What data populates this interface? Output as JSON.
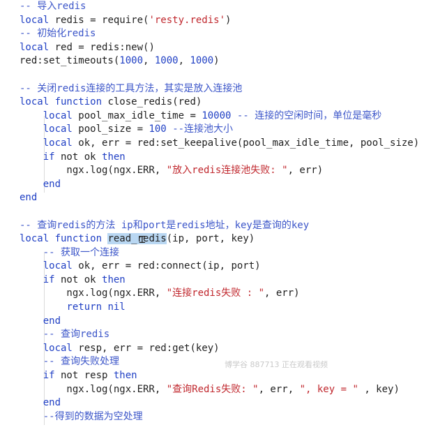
{
  "editor": {
    "lines": [
      {
        "n": "",
        "segs": [
          [
            "cm",
            "-- 导入redis"
          ]
        ]
      },
      {
        "n": "",
        "segs": [
          [
            "kw",
            "local"
          ],
          [
            "plain",
            " redis = require("
          ],
          [
            "str",
            "'resty.redis'"
          ],
          [
            "plain",
            ")"
          ]
        ]
      },
      {
        "n": "",
        "segs": [
          [
            "cm",
            "-- 初始化redis"
          ]
        ]
      },
      {
        "n": "",
        "segs": [
          [
            "kw",
            "local"
          ],
          [
            "plain",
            " red = redis:new()"
          ]
        ]
      },
      {
        "n": "",
        "segs": [
          [
            "plain",
            "red:set_timeouts("
          ],
          [
            "num",
            "1000"
          ],
          [
            "plain",
            ", "
          ],
          [
            "num",
            "1000"
          ],
          [
            "plain",
            ", "
          ],
          [
            "num",
            "1000"
          ],
          [
            "plain",
            ")"
          ]
        ]
      },
      {
        "n": "",
        "segs": []
      },
      {
        "n": "",
        "segs": [
          [
            "cm",
            "-- 关闭redis连接的工具方法，其实是放入连接池"
          ]
        ]
      },
      {
        "n": "",
        "segs": [
          [
            "kw",
            "local function"
          ],
          [
            "plain",
            " close_redis(red)"
          ]
        ]
      },
      {
        "n": "",
        "segs": [
          [
            "plain",
            "    "
          ],
          [
            "kw",
            "local"
          ],
          [
            "plain",
            " pool_max_idle_time = "
          ],
          [
            "num",
            "10000"
          ],
          [
            "plain",
            " "
          ],
          [
            "cm",
            "-- 连接的空闲时间，单位是毫秒"
          ]
        ]
      },
      {
        "n": "",
        "segs": [
          [
            "plain",
            "    "
          ],
          [
            "kw",
            "local"
          ],
          [
            "plain",
            " pool_size = "
          ],
          [
            "num",
            "100"
          ],
          [
            "plain",
            " "
          ],
          [
            "cm",
            "--连接池大小"
          ]
        ]
      },
      {
        "n": "",
        "segs": [
          [
            "plain",
            "    "
          ],
          [
            "kw",
            "local"
          ],
          [
            "plain",
            " ok, err = red:set_keepalive(pool_max_idle_time, pool_size)"
          ]
        ]
      },
      {
        "n": "",
        "segs": [
          [
            "plain",
            "    "
          ],
          [
            "kw",
            "if"
          ],
          [
            "plain",
            " not ok "
          ],
          [
            "kw",
            "then"
          ]
        ]
      },
      {
        "n": "",
        "segs": [
          [
            "plain",
            "        ngx.log(ngx.ERR, "
          ],
          [
            "str",
            "\"放入redis连接池失败: \""
          ],
          [
            "plain",
            ", err)"
          ]
        ]
      },
      {
        "n": "",
        "segs": [
          [
            "plain",
            "    "
          ],
          [
            "kw",
            "end"
          ]
        ]
      },
      {
        "n": "",
        "segs": [
          [
            "kw",
            "end"
          ]
        ]
      },
      {
        "n": "",
        "segs": []
      },
      {
        "n": "",
        "segs": [
          [
            "cm",
            "-- 查询redis的方法 ip和port是redis地址，key是查询的key"
          ]
        ]
      },
      {
        "n": "",
        "segs": [
          [
            "kw",
            "local function"
          ],
          [
            "plain",
            " "
          ],
          [
            "hl",
            "read_redis"
          ],
          [
            "plain",
            "(ip, port, key)"
          ]
        ]
      },
      {
        "n": "",
        "segs": [
          [
            "plain",
            "    "
          ],
          [
            "cm",
            "-- 获取一个连接"
          ]
        ]
      },
      {
        "n": "",
        "segs": [
          [
            "plain",
            "    "
          ],
          [
            "kw",
            "local"
          ],
          [
            "plain",
            " ok, err = red:connect(ip, port)"
          ]
        ]
      },
      {
        "n": "",
        "segs": [
          [
            "plain",
            "    "
          ],
          [
            "kw",
            "if"
          ],
          [
            "plain",
            " not ok "
          ],
          [
            "kw",
            "then"
          ]
        ]
      },
      {
        "n": "",
        "segs": [
          [
            "plain",
            "        ngx.log(ngx.ERR, "
          ],
          [
            "str",
            "\"连接redis失败 : \""
          ],
          [
            "plain",
            ", err)"
          ]
        ]
      },
      {
        "n": "",
        "segs": [
          [
            "plain",
            "        "
          ],
          [
            "kw",
            "return"
          ],
          [
            "plain",
            " "
          ],
          [
            "kw",
            "nil"
          ]
        ]
      },
      {
        "n": "",
        "segs": [
          [
            "plain",
            "    "
          ],
          [
            "kw",
            "end"
          ]
        ]
      },
      {
        "n": "",
        "segs": [
          [
            "plain",
            "    "
          ],
          [
            "cm",
            "-- 查询redis"
          ]
        ]
      },
      {
        "n": "",
        "segs": [
          [
            "plain",
            "    "
          ],
          [
            "kw",
            "local"
          ],
          [
            "plain",
            " resp, err = red:get(key)"
          ]
        ]
      },
      {
        "n": "",
        "segs": [
          [
            "plain",
            "    "
          ],
          [
            "cm",
            "-- 查询失败处理"
          ]
        ]
      },
      {
        "n": "",
        "segs": [
          [
            "plain",
            "    "
          ],
          [
            "kw",
            "if"
          ],
          [
            "plain",
            " not resp "
          ],
          [
            "kw",
            "then"
          ]
        ]
      },
      {
        "n": "",
        "segs": [
          [
            "plain",
            "        ngx.log(ngx.ERR, "
          ],
          [
            "str",
            "\"查询Redis失败: \""
          ],
          [
            "plain",
            ", err, "
          ],
          [
            "str",
            "\", key = \""
          ],
          [
            "plain",
            " , key)"
          ]
        ]
      },
      {
        "n": "",
        "segs": [
          [
            "plain",
            "    "
          ],
          [
            "kw",
            "end"
          ]
        ]
      },
      {
        "n": "",
        "segs": [
          [
            "plain",
            "    "
          ],
          [
            "cm",
            "--得到的数据为空处理"
          ]
        ]
      }
    ]
  },
  "watermark": "博学谷 887713 正在观看视频",
  "colors": {
    "keyword": "#1f3fc4",
    "comment": "#3c56c9",
    "string": "#c0272d",
    "selection": "#b9d7f2"
  }
}
